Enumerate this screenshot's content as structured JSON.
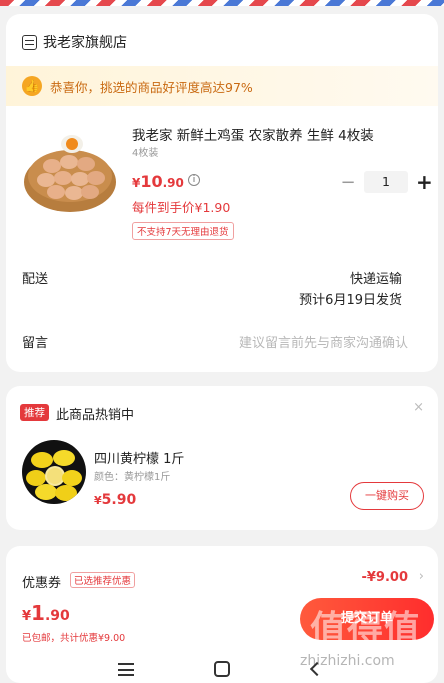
{
  "store": {
    "name": "我老家旗舰店"
  },
  "promo": {
    "text": "恭喜你，挑选的商品好评度高达97%"
  },
  "product": {
    "title": "我老家 新鲜土鸡蛋 农家散养 生鲜 4枚装",
    "spec": "4枚装",
    "price_symbol": "¥",
    "price_int": "10",
    "price_dec": ".90",
    "quantity": "1",
    "qty_minus": "−",
    "qty_plus": "+",
    "hand_price": "每件到手价¥1.90",
    "no_return": "不支持7天无理由退货"
  },
  "delivery": {
    "label": "配送",
    "method": "快递运输",
    "estimate": "预计6月19日发货"
  },
  "note": {
    "label": "留言",
    "placeholder": "建议留言前先与商家沟通确认"
  },
  "recommend": {
    "tag": "推荐",
    "title": "此商品热销中",
    "close": "×",
    "name": "四川黄柠檬 1斤",
    "color": "颜色：黄柠檬1斤",
    "price_symbol": "¥",
    "price": "5.90",
    "buy_label": "一键购买"
  },
  "coupon": {
    "label": "优惠券",
    "tag": "已选推荐优惠",
    "value": "-¥9.00",
    "arrow": "›"
  },
  "footer": {
    "total_symbol": "¥",
    "total_int": "1",
    "total_dec": ".90",
    "sub": "已包邮，共计优惠¥9.00",
    "submit_label": "提交订单"
  },
  "watermark": {
    "logo": "值得值",
    "url": "zhizhizhi.com"
  },
  "colors": {
    "accent": "#e4393c",
    "promo_bg": "#fff4d9",
    "promo_text": "#c96a12"
  },
  "icons": [
    "store-icon",
    "thumbs-up-icon",
    "info-icon",
    "close-icon",
    "chevron-right-icon",
    "menu-icon",
    "home-icon",
    "back-icon"
  ]
}
